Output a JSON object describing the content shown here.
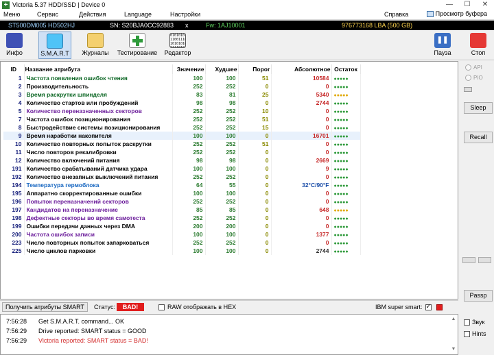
{
  "window": {
    "title": "Victoria 5.37 HDD/SSD | Device 0",
    "minimize": "—",
    "maximize": "☐",
    "close": "✕"
  },
  "menu": {
    "items": [
      "Меню",
      "Сервис",
      "Действия",
      "Language",
      "Настройки",
      "Справка"
    ],
    "buffer_view": "Просмотр буфера"
  },
  "drive": {
    "model": "ST500DM005 HD502HJ",
    "serial": "SN: S20BJA0CC92883",
    "close_x": "x",
    "firmware": "Fw: 1AJ10001",
    "capacity": "976773168 LBA (500 GB)"
  },
  "toolbar": {
    "info": "Инфо",
    "smart": "S.M.A.R.T",
    "logs": "Журналы",
    "testing": "Тестирование",
    "editor": "Редактор",
    "pause": "Пауза",
    "stop": "Стоп",
    "editor_bits": "01010101 11001110 10101010 01110101"
  },
  "smart_table": {
    "headers": {
      "id": "ID",
      "name": "Название атрибута",
      "value": "Значение",
      "worst": "Худшее",
      "threshold": "Порог",
      "raw": "Абсолютное",
      "status": "Остаток"
    },
    "rows": [
      {
        "id": "1",
        "name": "Частота появления ошибок чтения",
        "value": "100",
        "worst": "100",
        "thr": "51",
        "raw": "10584",
        "status": "●●●●●",
        "name_color": "green",
        "raw_color": "red",
        "dot_color": "green"
      },
      {
        "id": "2",
        "name": "Производительность",
        "value": "252",
        "worst": "252",
        "thr": "0",
        "raw": "0",
        "status": "●●●●●",
        "name_color": "default",
        "raw_color": "red",
        "dot_color": "green"
      },
      {
        "id": "3",
        "name": "Время раскрутки шпинделя",
        "value": "83",
        "worst": "81",
        "thr": "25",
        "raw": "5340",
        "status": "●●●●●",
        "name_color": "green",
        "raw_color": "red",
        "dot_color": "yellow"
      },
      {
        "id": "4",
        "name": "Количество стартов или пробуждений",
        "value": "98",
        "worst": "98",
        "thr": "0",
        "raw": "2744",
        "status": "●●●●●",
        "name_color": "default",
        "raw_color": "red",
        "dot_color": "green"
      },
      {
        "id": "5",
        "name": "Количество переназначенных секторов",
        "value": "252",
        "worst": "252",
        "thr": "10",
        "raw": "0",
        "status": "●●●●●",
        "name_color": "purple",
        "raw_color": "red",
        "dot_color": "green"
      },
      {
        "id": "7",
        "name": "Частота ошибок позиционирования",
        "value": "252",
        "worst": "252",
        "thr": "51",
        "raw": "0",
        "status": "●●●●●",
        "name_color": "default",
        "raw_color": "red",
        "dot_color": "green"
      },
      {
        "id": "8",
        "name": "Быстродействие системы позиционирования",
        "value": "252",
        "worst": "252",
        "thr": "15",
        "raw": "0",
        "status": "●●●●●",
        "name_color": "default",
        "raw_color": "red",
        "dot_color": "green"
      },
      {
        "id": "9",
        "name": "Время наработки накопителя",
        "value": "100",
        "worst": "100",
        "thr": "0",
        "raw": "16701",
        "status": "●●●●●",
        "name_color": "default",
        "raw_color": "red",
        "dot_color": "green",
        "selected": true
      },
      {
        "id": "10",
        "name": "Количество повторных попыток раскрутки",
        "value": "252",
        "worst": "252",
        "thr": "51",
        "raw": "0",
        "status": "●●●●●",
        "name_color": "default",
        "raw_color": "red",
        "dot_color": "green"
      },
      {
        "id": "11",
        "name": "Число повторов рекалибровки",
        "value": "252",
        "worst": "252",
        "thr": "0",
        "raw": "0",
        "status": "●●●●●",
        "name_color": "default",
        "raw_color": "red",
        "dot_color": "green"
      },
      {
        "id": "12",
        "name": "Количество включений питания",
        "value": "98",
        "worst": "98",
        "thr": "0",
        "raw": "2669",
        "status": "●●●●●",
        "name_color": "default",
        "raw_color": "red",
        "dot_color": "green"
      },
      {
        "id": "191",
        "name": "Количество срабатываний датчика удара",
        "value": "100",
        "worst": "100",
        "thr": "0",
        "raw": "9",
        "status": "●●●●●",
        "name_color": "default",
        "raw_color": "red",
        "dot_color": "green"
      },
      {
        "id": "192",
        "name": "Количество внезапных выключений питания",
        "value": "252",
        "worst": "252",
        "thr": "0",
        "raw": "0",
        "status": "●●●●●",
        "name_color": "default",
        "raw_color": "red",
        "dot_color": "green"
      },
      {
        "id": "194",
        "name": "Температура гермоблока",
        "value": "64",
        "worst": "55",
        "thr": "0",
        "raw": "32°C/90°F",
        "status": "●●●●●",
        "name_color": "blue",
        "raw_color": "blue",
        "dot_color": "green"
      },
      {
        "id": "195",
        "name": "Аппаратно скорректированные ошибки",
        "value": "100",
        "worst": "100",
        "thr": "0",
        "raw": "0",
        "status": "●●●●●",
        "name_color": "default",
        "raw_color": "red",
        "dot_color": "green"
      },
      {
        "id": "196",
        "name": "Попыток переназначений секторов",
        "value": "252",
        "worst": "252",
        "thr": "0",
        "raw": "0",
        "status": "●●●●●",
        "name_color": "purple",
        "raw_color": "red",
        "dot_color": "green"
      },
      {
        "id": "197",
        "name": "Кандидатов на переназначение",
        "value": "85",
        "worst": "85",
        "thr": "0",
        "raw": "648",
        "status": "●●●●●",
        "name_color": "purple",
        "raw_color": "red",
        "dot_color": "yellow"
      },
      {
        "id": "198",
        "name": "Дефектные секторы во время самотеста",
        "value": "252",
        "worst": "252",
        "thr": "0",
        "raw": "0",
        "status": "●●●●●",
        "name_color": "purple",
        "raw_color": "red",
        "dot_color": "green"
      },
      {
        "id": "199",
        "name": "Ошибки передачи данных через DMA",
        "value": "200",
        "worst": "200",
        "thr": "0",
        "raw": "0",
        "status": "●●●●●",
        "name_color": "default",
        "raw_color": "red",
        "dot_color": "green"
      },
      {
        "id": "200",
        "name": "Частота ошибок записи",
        "value": "100",
        "worst": "100",
        "thr": "0",
        "raw": "1377",
        "status": "●●●●●",
        "name_color": "purple",
        "raw_color": "red",
        "dot_color": "green"
      },
      {
        "id": "223",
        "name": "Число повторных попыток запарковаться",
        "value": "252",
        "worst": "252",
        "thr": "0",
        "raw": "0",
        "status": "●●●●●",
        "name_color": "default",
        "raw_color": "red",
        "dot_color": "green"
      },
      {
        "id": "225",
        "name": "Число циклов парковки",
        "value": "100",
        "worst": "100",
        "thr": "0",
        "raw": "2744",
        "status": "●●●●●",
        "name_color": "default",
        "raw_color": "dark",
        "dot_color": "green"
      }
    ]
  },
  "side_panel": {
    "api": "API",
    "pio": "PIO",
    "sleep": "Sleep",
    "recall": "Recall",
    "passp": "Passp"
  },
  "statusbar": {
    "get_attrs": "Получить атрибуты SMART",
    "status_label": "Статус:",
    "status_value": "BAD!",
    "raw_hex": "RAW отображать в HEX",
    "ibm_smart": "IBM super smart:"
  },
  "log": [
    {
      "time": "7:56:28",
      "text": "Get S.M.A.R.T. command... OK",
      "color": "black"
    },
    {
      "time": "7:56:29",
      "text": "Drive reported: SMART status = GOOD",
      "color": "black"
    },
    {
      "time": "7:56:29",
      "text": "Victoria reported: SMART status = BAD!",
      "color": "red"
    }
  ],
  "bottom_side": {
    "sound": "Звук",
    "hints": "Hints"
  },
  "colors": {
    "status_bad": "#e11d1d",
    "dots_green": "#2e9a3a",
    "dots_yellow": "#e0a800",
    "raw_red": "#c62828"
  }
}
